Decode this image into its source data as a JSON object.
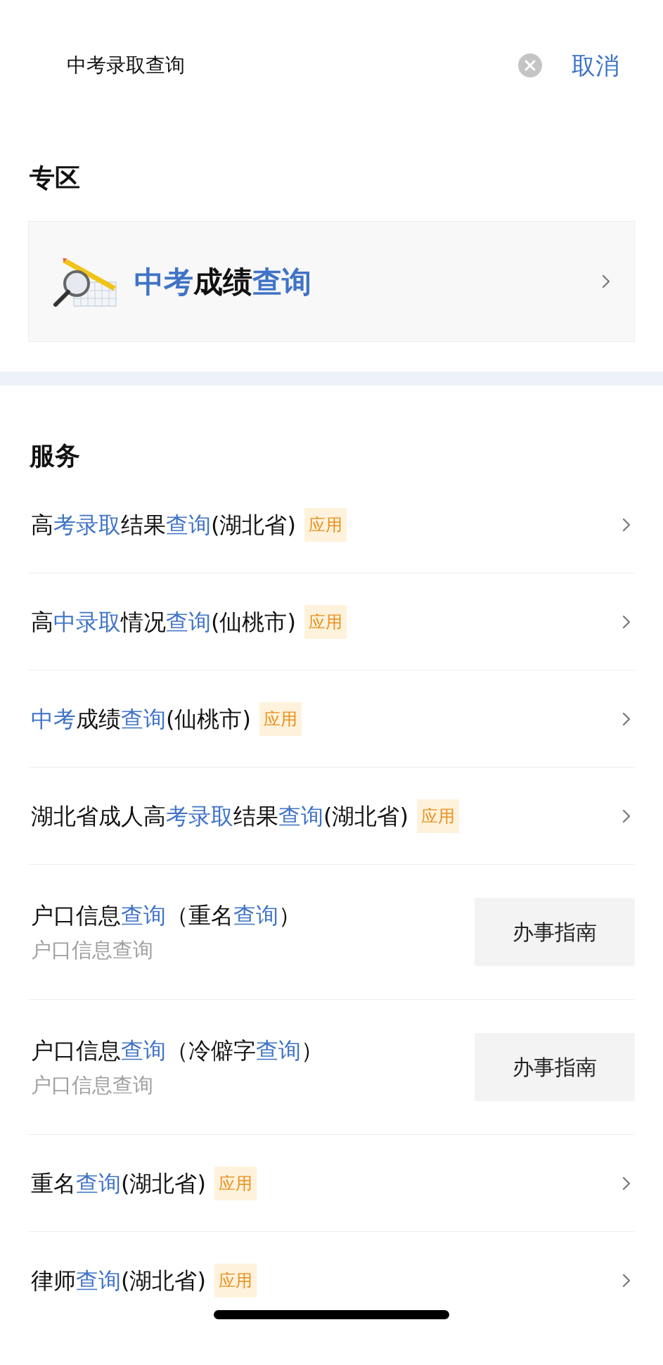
{
  "search": {
    "value": "中考录取查询",
    "cancel": "取消"
  },
  "zone": {
    "heading": "专区",
    "card": {
      "title": [
        {
          "text": "中考",
          "highlight": true
        },
        {
          "text": "成绩",
          "highlight": false
        },
        {
          "text": "查询",
          "highlight": true
        }
      ]
    }
  },
  "services": {
    "heading": "服务",
    "items": [
      {
        "kind": "app",
        "title": [
          {
            "text": "高",
            "highlight": false
          },
          {
            "text": "考录取",
            "highlight": true
          },
          {
            "text": "结果",
            "highlight": false
          },
          {
            "text": "查询",
            "highlight": true
          },
          {
            "text": "(湖北省)",
            "highlight": false
          }
        ],
        "badge": "应用"
      },
      {
        "kind": "app",
        "title": [
          {
            "text": "高",
            "highlight": false
          },
          {
            "text": "中录取",
            "highlight": true
          },
          {
            "text": "情况",
            "highlight": false
          },
          {
            "text": "查询",
            "highlight": true
          },
          {
            "text": "(仙桃市)",
            "highlight": false
          }
        ],
        "badge": "应用"
      },
      {
        "kind": "app",
        "title": [
          {
            "text": "中考",
            "highlight": true
          },
          {
            "text": "成绩",
            "highlight": false
          },
          {
            "text": "查询",
            "highlight": true
          },
          {
            "text": "(仙桃市)",
            "highlight": false
          }
        ],
        "badge": "应用"
      },
      {
        "kind": "app",
        "title": [
          {
            "text": "湖北省成人高",
            "highlight": false
          },
          {
            "text": "考录取",
            "highlight": true
          },
          {
            "text": "结果",
            "highlight": false
          },
          {
            "text": "查询",
            "highlight": true
          },
          {
            "text": "(湖北省)",
            "highlight": false
          }
        ],
        "badge": "应用"
      },
      {
        "kind": "guide",
        "title": [
          {
            "text": "户口信息",
            "highlight": false
          },
          {
            "text": "查询",
            "highlight": true
          },
          {
            "text": "（重名",
            "highlight": false
          },
          {
            "text": "查询",
            "highlight": true
          },
          {
            "text": "）",
            "highlight": false
          }
        ],
        "subtitle": "户口信息查询",
        "button": "办事指南"
      },
      {
        "kind": "guide",
        "title": [
          {
            "text": "户口信息",
            "highlight": false
          },
          {
            "text": "查询",
            "highlight": true
          },
          {
            "text": "（冷僻字",
            "highlight": false
          },
          {
            "text": "查询",
            "highlight": true
          },
          {
            "text": "）",
            "highlight": false
          }
        ],
        "subtitle": "户口信息查询",
        "button": "办事指南"
      },
      {
        "kind": "app",
        "title": [
          {
            "text": "重名",
            "highlight": false
          },
          {
            "text": "查询",
            "highlight": true
          },
          {
            "text": "(湖北省)",
            "highlight": false
          }
        ],
        "badge": "应用"
      },
      {
        "kind": "app",
        "title": [
          {
            "text": "律师",
            "highlight": false
          },
          {
            "text": "查询",
            "highlight": true
          },
          {
            "text": "(湖北省)",
            "highlight": false
          }
        ],
        "badge": "应用"
      }
    ]
  }
}
